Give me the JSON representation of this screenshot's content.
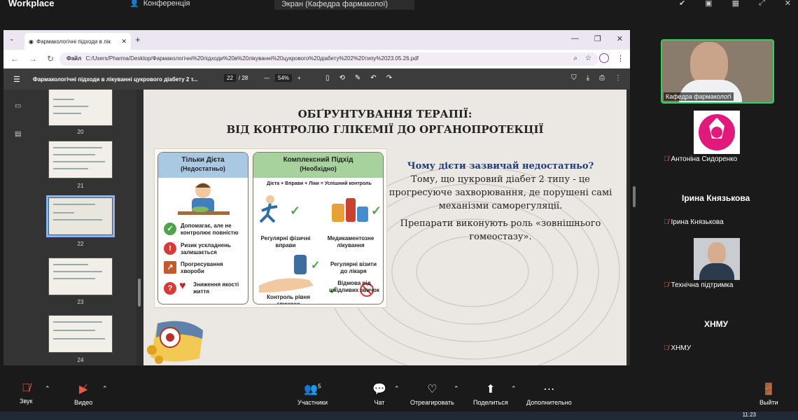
{
  "topbar": {
    "app_name": "Workplace",
    "conference_tab": "Конференція",
    "screen_tab": "Экран (Кафедра фармаколої)"
  },
  "browser": {
    "tab_title": "Фармакологічні підходи в лік",
    "url_prefix": "Файл",
    "url": "C:/Users/Pharma/Desktop/Фармакологічні%20підходи%20в%20лікуванні%20цукрового%20діабету%202%20типу%2023.05.26.pdf"
  },
  "pdf_toolbar": {
    "doc_title": "Фармакологічні підходи в лікуванні цукрового діабету 2 т...",
    "current_page": "22",
    "total_pages": "/ 28",
    "zoom": "54%"
  },
  "thumbnails": [
    {
      "num": "20"
    },
    {
      "num": "21"
    },
    {
      "num": "22"
    },
    {
      "num": "23"
    },
    {
      "num": "24"
    }
  ],
  "slide": {
    "title_line1": "ОБҐРУНТУВАННЯ ТЕРАПІЇ:",
    "title_line2": "ВІД КОНТРОЛЮ ГЛІКЕМІЇ ДО ОРГАНОПРОТЕКЦІЇ",
    "left_panel": {
      "title": "Тільки Дієта",
      "subtitle": "(Недостатньо)",
      "items": [
        "Допомагає, але не контролює повністю",
        "Ризик ускладнень залишається",
        "Прогресування хвороби",
        "Зниження якості життя"
      ]
    },
    "right_panel": {
      "title": "Комплексний Підхід",
      "subtitle": "(Необхідно)",
      "formula": "Дієта + Вправи + Ліки = Успішний контроль",
      "items": [
        "Регулярні фізичні вправи",
        "Медикаментозне лікування",
        "Регулярні візити до лікаря",
        "Відмова від шкідливих звичок",
        "Контроль рівня глюкози"
      ]
    },
    "question": "Чому дієти зазвичай недостатньо?",
    "answer": "Тому, що цукровий діабет 2 типу - це прогресуюче захворювання, де порушені самі механізми саморегуляції.",
    "answer2": "Препарати виконують роль «зовнішнього гомеостазу»."
  },
  "participants": {
    "video_label": "Кафедра фармаколоґі",
    "p1": "Антоніна Сидоренко",
    "p2_big": "Ірина Князькова",
    "p2": "Ірина Князькова",
    "p3": "Технічна підтримка",
    "p4_big": "ХНМУ",
    "p4": "ХНМУ"
  },
  "bottombar": {
    "sound": "Звук",
    "video": "Видео",
    "participants": "Участники",
    "participants_count": "5",
    "chat": "Чат",
    "react": "Отреагировать",
    "share": "Поделиться",
    "more": "Дополнительно",
    "leave": "Выйти"
  },
  "taskbar": {
    "time": "11:23"
  }
}
